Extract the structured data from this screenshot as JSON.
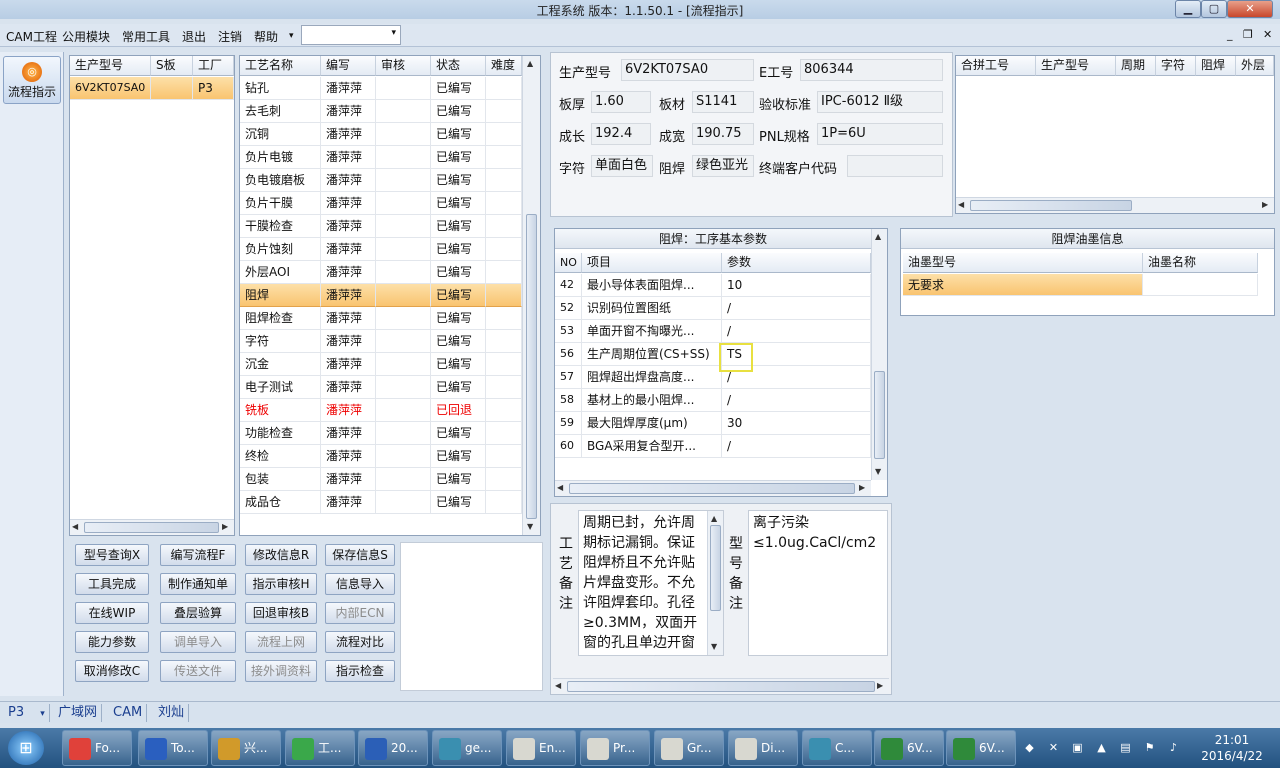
{
  "window": {
    "title": "工程系统  版本：1.1.50.1 - [流程指示]",
    "minimize": "▁",
    "maximize": "▢",
    "close": "✕"
  },
  "menu": {
    "items": [
      "CAM工程",
      "公用模块",
      "常用工具",
      "退出",
      "注销",
      "帮助"
    ],
    "help_arrow": "▾",
    "combo_value": "",
    "combo_arrow": "▾",
    "mdi_min": "_",
    "mdi_restore": "❐",
    "mdi_close": "✕"
  },
  "nav": {
    "flow_label": "流程指示",
    "flow_icon_glyph": "◎"
  },
  "parts": {
    "headers": [
      "生产型号",
      "S板",
      "工厂"
    ],
    "rows": [
      {
        "model": "6V2KT07SA0",
        "s": "",
        "factory": "P3"
      }
    ]
  },
  "process": {
    "headers": [
      "工艺名称",
      "编写",
      "审核",
      "状态",
      "难度"
    ],
    "rows": [
      {
        "name": "钻孔",
        "writer": "潘萍萍",
        "review": "",
        "status": "已编写",
        "diff": ""
      },
      {
        "name": "去毛刺",
        "writer": "潘萍萍",
        "review": "",
        "status": "已编写",
        "diff": ""
      },
      {
        "name": "沉铜",
        "writer": "潘萍萍",
        "review": "",
        "status": "已编写",
        "diff": ""
      },
      {
        "name": "负片电镀",
        "writer": "潘萍萍",
        "review": "",
        "status": "已编写",
        "diff": ""
      },
      {
        "name": "负电镀磨板",
        "writer": "潘萍萍",
        "review": "",
        "status": "已编写",
        "diff": ""
      },
      {
        "name": "负片干膜",
        "writer": "潘萍萍",
        "review": "",
        "status": "已编写",
        "diff": ""
      },
      {
        "name": "干膜检查",
        "writer": "潘萍萍",
        "review": "",
        "status": "已编写",
        "diff": ""
      },
      {
        "name": "负片蚀刻",
        "writer": "潘萍萍",
        "review": "",
        "status": "已编写",
        "diff": ""
      },
      {
        "name": "外层AOI",
        "writer": "潘萍萍",
        "review": "",
        "status": "已编写",
        "diff": ""
      },
      {
        "name": "阻焊",
        "writer": "潘萍萍",
        "review": "",
        "status": "已编写",
        "diff": ""
      },
      {
        "name": "阻焊检查",
        "writer": "潘萍萍",
        "review": "",
        "status": "已编写",
        "diff": ""
      },
      {
        "name": "字符",
        "writer": "潘萍萍",
        "review": "",
        "status": "已编写",
        "diff": ""
      },
      {
        "name": "沉金",
        "writer": "潘萍萍",
        "review": "",
        "status": "已编写",
        "diff": ""
      },
      {
        "name": "电子测试",
        "writer": "潘萍萍",
        "review": "",
        "status": "已编写",
        "diff": ""
      },
      {
        "name": "铣板",
        "writer": "潘萍萍",
        "review": "",
        "status": "已回退",
        "diff": ""
      },
      {
        "name": "功能检查",
        "writer": "潘萍萍",
        "review": "",
        "status": "已编写",
        "diff": ""
      },
      {
        "name": "终检",
        "writer": "潘萍萍",
        "review": "",
        "status": "已编写",
        "diff": ""
      },
      {
        "name": "包装",
        "writer": "潘萍萍",
        "review": "",
        "status": "已编写",
        "diff": ""
      },
      {
        "name": "成品仓",
        "writer": "潘萍萍",
        "review": "",
        "status": "已编写",
        "diff": ""
      }
    ]
  },
  "buttons": [
    [
      "型号查询X",
      "编写流程F",
      "修改信息R",
      "保存信息S"
    ],
    [
      "工具完成",
      "制作通知单",
      "指示审核H",
      "信息导入"
    ],
    [
      "在线WIP",
      "叠层验算",
      "回退审核B",
      "内部ECN"
    ],
    [
      "能力参数",
      "调单导入",
      "流程上网",
      "流程对比"
    ],
    [
      "取消修改C",
      "传送文件",
      "接外调资料",
      "指示检查"
    ]
  ],
  "info": {
    "model_label": "生产型号",
    "model": "6V2KT07SA0",
    "e_label": "E工号",
    "e": "806344",
    "thick_label": "板厚",
    "thick": "1.60",
    "material_label": "板材",
    "material": "S1141",
    "std_label": "验收标准",
    "std": "IPC-6012 Ⅱ级",
    "len_label": "成长",
    "len": "192.4",
    "wid_label": "成宽",
    "wid": "190.75",
    "pnl_label": "PNL规格",
    "pnl": "1P=6U",
    "char_label": "字符",
    "char": "单面白色",
    "mask_label": "阻焊",
    "mask": "绿色亚光",
    "cust_label": "终端客户代码",
    "cust": ""
  },
  "merge": {
    "headers": [
      "合拼工号",
      "生产型号",
      "周期",
      "字符",
      "阻焊",
      "外层"
    ]
  },
  "params": {
    "title": "阻焊：工序基本参数",
    "headers": [
      "NO",
      "项目",
      "参数"
    ],
    "rows": [
      {
        "no": "42",
        "item": "最小导体表面阻焊...",
        "val": "10"
      },
      {
        "no": "52",
        "item": "识别码位置图纸",
        "val": "/"
      },
      {
        "no": "53",
        "item": "单面开窗不掏曝光...",
        "val": "/"
      },
      {
        "no": "56",
        "item": "生产周期位置(CS+SS)",
        "val": "TS"
      },
      {
        "no": "57",
        "item": "阻焊超出焊盘高度...",
        "val": "/"
      },
      {
        "no": "58",
        "item": "基材上的最小阻焊...",
        "val": "/"
      },
      {
        "no": "59",
        "item": "最大阻焊厚度(μm)",
        "val": "30"
      },
      {
        "no": "60",
        "item": "BGA采用复合型开...",
        "val": "/"
      }
    ]
  },
  "ink": {
    "title": "阻焊油墨信息",
    "headers": [
      "油墨型号",
      "油墨名称"
    ],
    "rows": [
      {
        "model": "无要求",
        "name": ""
      }
    ]
  },
  "notes": {
    "process_label": [
      "工",
      "艺",
      "备",
      "注"
    ],
    "process_text": "周期已封，允许周期标记漏铜。保证阻焊桥且不允许贴片焊盘变形。不允许阻焊套印。孔径≥0.3MM，双面开窗的孔且单边开窗",
    "type_label": [
      "型",
      "号",
      "备",
      "注"
    ],
    "type_text": "离子污染≤1.0ug.CaCl/cm2"
  },
  "status": {
    "factory": "P3",
    "arrow": "▾",
    "net": "广域网",
    "dept": "CAM",
    "user": "刘灿"
  },
  "taskbar": {
    "start_glyph": "⊞",
    "items": [
      {
        "label": "Fo...",
        "color": "#e0413a"
      },
      {
        "label": "To...",
        "color": "#2a5fbf"
      },
      {
        "label": "兴...",
        "color": "#d19a2a"
      },
      {
        "label": "工...",
        "color": "#3aa84a"
      },
      {
        "label": "20...",
        "color": "#2b5fb7"
      },
      {
        "label": "ge...",
        "color": "#3a8fb0"
      },
      {
        "label": "En...",
        "color": "#d8d8d0"
      },
      {
        "label": "Pr...",
        "color": "#d8d8d0"
      },
      {
        "label": "Gr...",
        "color": "#d8d8d0"
      },
      {
        "label": "Di...",
        "color": "#d8d8d0"
      },
      {
        "label": "C...",
        "color": "#3a8fb0"
      },
      {
        "label": "6V...",
        "color": "#2f8a3a"
      },
      {
        "label": "6V...",
        "color": "#2f8a3a"
      }
    ],
    "time": "21:01",
    "date": "2016/4/22"
  }
}
